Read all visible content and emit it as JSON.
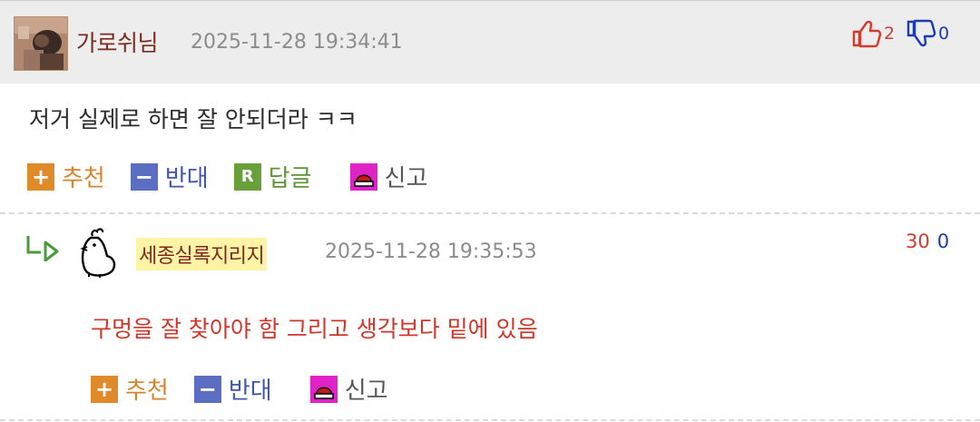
{
  "comments": [
    {
      "nickname": "가로쉬님",
      "timestamp": "2025-11-28 19:34:41",
      "likes": "2",
      "dislikes": "0",
      "body": "저거 실제로 하면 잘 안되더라 ㅋㅋ",
      "actions": {
        "recommend": "추천",
        "oppose": "반대",
        "reply": "답글",
        "report": "신고"
      },
      "icons": {
        "recommend": "+",
        "oppose": "−",
        "reply": "R"
      }
    },
    {
      "nickname": "세종실록지리지",
      "timestamp": "2025-11-28 19:35:53",
      "likes": "30",
      "dislikes": "0",
      "body": "구멍을 잘 찾아야 함 그리고 생각보다 밑에 있음",
      "actions": {
        "recommend": "추천",
        "oppose": "반대",
        "report": "신고"
      },
      "icons": {
        "recommend": "+",
        "oppose": "−"
      }
    }
  ],
  "colors": {
    "header_bg": "#ededed",
    "nickname": "#7a2a1e",
    "timestamp": "#8c8c8c",
    "like": "#d23b2f",
    "dislike": "#1f3bb3",
    "reply_body": "#d2352a",
    "recommend": "#e08a2a",
    "oppose": "#5b6ec2",
    "reply": "#6aa03a",
    "report": "#e023c7"
  }
}
